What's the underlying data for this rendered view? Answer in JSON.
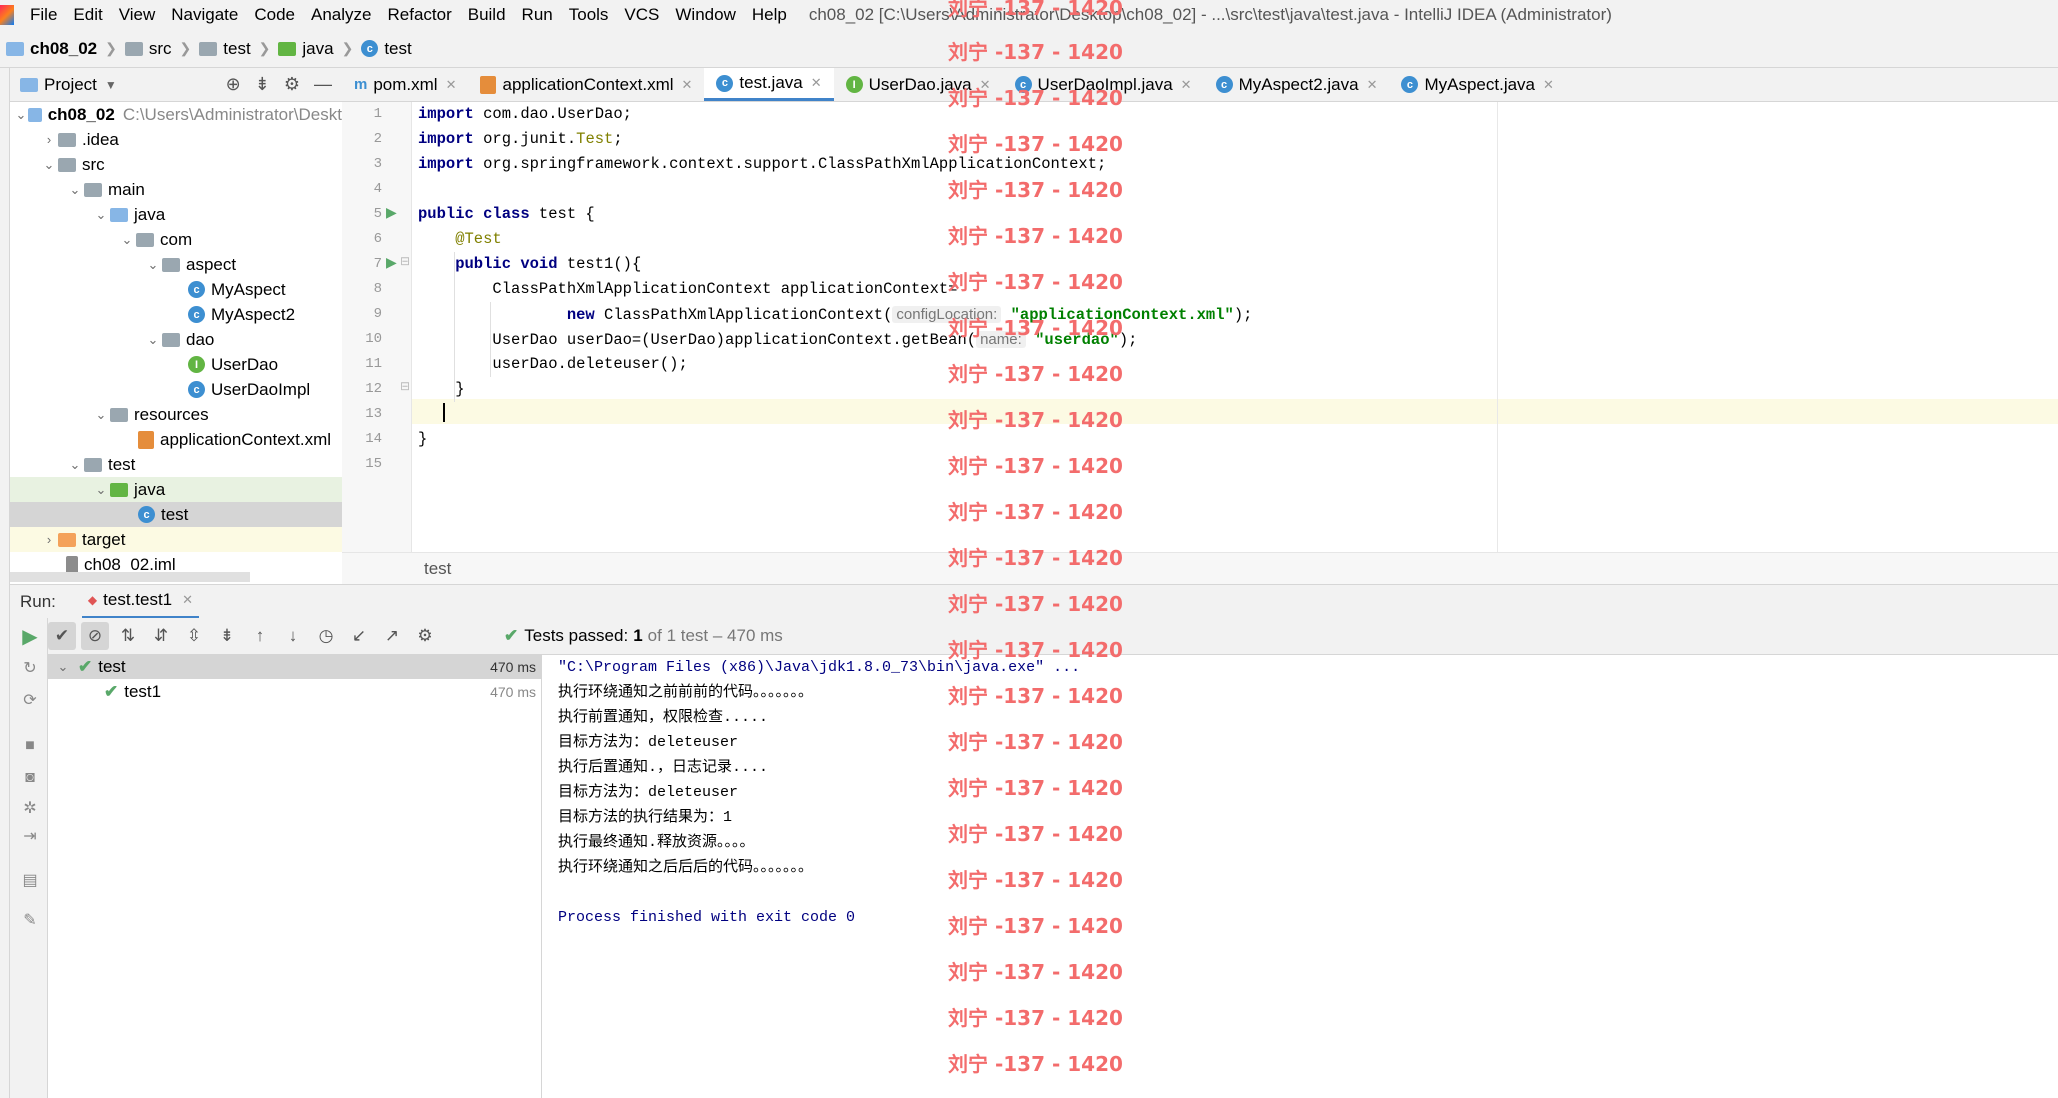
{
  "menubar": {
    "items": [
      "File",
      "Edit",
      "View",
      "Navigate",
      "Code",
      "Analyze",
      "Refactor",
      "Build",
      "Run",
      "Tools",
      "VCS",
      "Window",
      "Help"
    ],
    "title": "ch08_02 [C:\\Users\\Administrator\\Desktop\\ch08_02] - ...\\src\\test\\java\\test.java - IntelliJ IDEA (Administrator)"
  },
  "breadcrumb": [
    "ch08_02",
    "src",
    "test",
    "java",
    "test"
  ],
  "project": {
    "title": "Project",
    "tree": [
      {
        "label": "ch08_02",
        "path": "C:\\Users\\Administrator\\Deskt",
        "icon": "module-folder-icon"
      },
      {
        "label": ".idea",
        "icon": "folder-icon"
      },
      {
        "label": "src",
        "icon": "folder-icon"
      },
      {
        "label": "main",
        "icon": "folder-icon"
      },
      {
        "label": "java",
        "icon": "source-folder-icon"
      },
      {
        "label": "com",
        "icon": "package-icon"
      },
      {
        "label": "aspect",
        "icon": "package-icon"
      },
      {
        "label": "MyAspect",
        "icon": "class-icon"
      },
      {
        "label": "MyAspect2",
        "icon": "class-icon"
      },
      {
        "label": "dao",
        "icon": "package-icon"
      },
      {
        "label": "UserDao",
        "icon": "interface-icon"
      },
      {
        "label": "UserDaoImpl",
        "icon": "class-icon"
      },
      {
        "label": "resources",
        "icon": "resources-folder-icon"
      },
      {
        "label": "applicationContext.xml",
        "icon": "xml-file-icon"
      },
      {
        "label": "test",
        "icon": "folder-icon"
      },
      {
        "label": "java",
        "icon": "test-source-folder-icon"
      },
      {
        "label": "test",
        "icon": "class-icon"
      },
      {
        "label": "target",
        "icon": "excluded-folder-icon"
      },
      {
        "label": "ch08_02.iml",
        "icon": "iml-file-icon"
      }
    ]
  },
  "tabs": [
    {
      "label": "pom.xml",
      "icon": "maven-icon"
    },
    {
      "label": "applicationContext.xml",
      "icon": "xml-file-icon"
    },
    {
      "label": "test.java",
      "icon": "class-icon",
      "active": true
    },
    {
      "label": "UserDao.java",
      "icon": "interface-icon"
    },
    {
      "label": "UserDaoImpl.java",
      "icon": "class-icon"
    },
    {
      "label": "MyAspect2.java",
      "icon": "class-icon"
    },
    {
      "label": "MyAspect.java",
      "icon": "class-icon"
    }
  ],
  "editor": {
    "line_numbers": [
      "1",
      "2",
      "3",
      "4",
      "5",
      "6",
      "7",
      "8",
      "9",
      "10",
      "11",
      "12",
      "13",
      "14",
      "15"
    ],
    "code": {
      "l1_kw": "import",
      "l1_rest": " com.dao.UserDao;",
      "l2_kw": "import",
      "l2_a": " org.junit.",
      "l2_ann": "Test",
      "l2_b": ";",
      "l3_kw": "import",
      "l3_rest": " org.springframework.context.support.ClassPathXmlApplicationContext;",
      "l5_kw1": "public",
      "l5_kw2": " class",
      "l5_rest": " test {",
      "l6_ann": "    @Test",
      "l7_kw1": "    public",
      "l7_kw2": " void",
      "l7_rest": " test1(){",
      "l8": "        ClassPathXmlApplicationContext applicationContext=",
      "l9_pre": "                ",
      "l9_kw": "new",
      "l9_a": " ClassPathXmlApplicationContext(",
      "l9_hint": "configLocation:",
      "l9_str": " \"applicationContext.xml\"",
      "l9_b": ");",
      "l10_a": "        UserDao userDao=(UserDao)applicationContext.getBean(",
      "l10_hint": "name:",
      "l10_str": " \"userdao\"",
      "l10_b": ");",
      "l11": "        userDao.deleteuser();",
      "l12": "    }",
      "l14": "}"
    },
    "footer_crumb": "test"
  },
  "run": {
    "label": "Run:",
    "tab": "test.test1",
    "status_bold": "Tests passed:",
    "status_count": "1",
    "status_detail": "of 1 test – 470 ms",
    "tree": [
      {
        "label": "test",
        "time": "470 ms"
      },
      {
        "label": "test1",
        "time": "470 ms"
      }
    ],
    "console": [
      "\"C:\\Program Files (x86)\\Java\\jdk1.8.0_73\\bin\\java.exe\" ...",
      "执行环绕通知之前前前的代码。。。。。。。",
      "执行前置通知，权限检查.....",
      "目标方法为：deleteuser",
      "执行后置通知.，日志记录....",
      "目标方法为：deleteuser",
      "目标方法的执行结果为：1",
      "执行最终通知.释放资源。。。。",
      "执行环绕通知之后后后的代码。。。。。。。",
      "",
      "Process finished with exit code 0"
    ]
  },
  "watermark": "刘宁 -137 - 1420",
  "colors": {
    "accent": "#4083c9",
    "keyword": "#000080",
    "string": "#008000",
    "annotation": "#808000",
    "pass": "#59a869",
    "watermark": "#f36c6c"
  }
}
